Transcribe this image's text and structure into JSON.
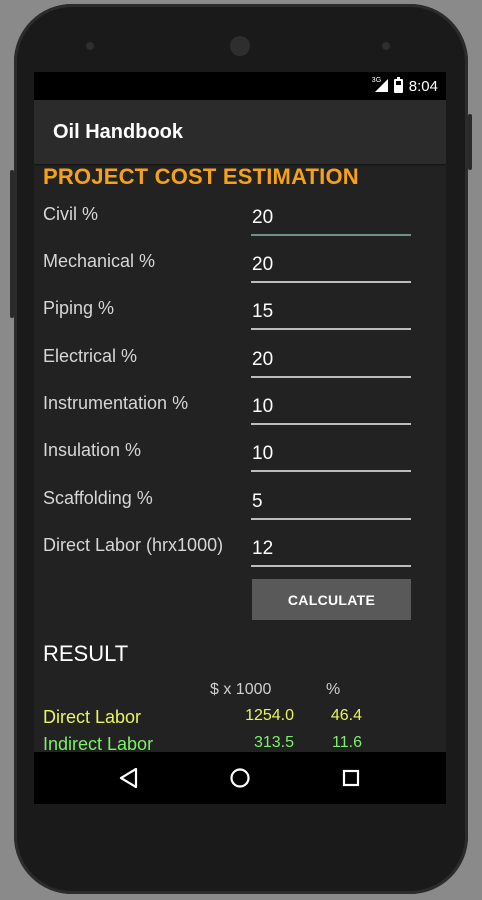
{
  "status_bar": {
    "network": "3G",
    "time": "8:04"
  },
  "app": {
    "title": "Oil Handbook"
  },
  "form": {
    "heading": "PROJECT COST ESTIMATION",
    "rows": [
      {
        "label": "Civil %",
        "value": "20"
      },
      {
        "label": "Mechanical %",
        "value": "20"
      },
      {
        "label": "Piping %",
        "value": "15"
      },
      {
        "label": "Electrical %",
        "value": "20"
      },
      {
        "label": "Instrumentation %",
        "value": "10"
      },
      {
        "label": "Insulation %",
        "value": "10"
      },
      {
        "label": "Scaffolding %",
        "value": "5"
      },
      {
        "label": "Direct Labor (hrx1000)",
        "value": "12"
      }
    ],
    "calculate_label": "CALCULATE"
  },
  "result": {
    "title": "RESULT",
    "col_money": "$ x 1000",
    "col_percent": "%",
    "rows": [
      {
        "name": "Direct Labor",
        "money": "1254.0",
        "percent": "46.4"
      },
      {
        "name": "Indirect Labor",
        "money": "313.5",
        "percent": "11.6"
      }
    ]
  },
  "colors": {
    "heading": "#f5a216",
    "result_direct": "#e6f55a",
    "result_indirect": "#7cf06a"
  },
  "nav": {
    "back_icon": "back-triangle-icon",
    "home_icon": "home-circle-icon",
    "recents_icon": "recents-square-icon"
  }
}
